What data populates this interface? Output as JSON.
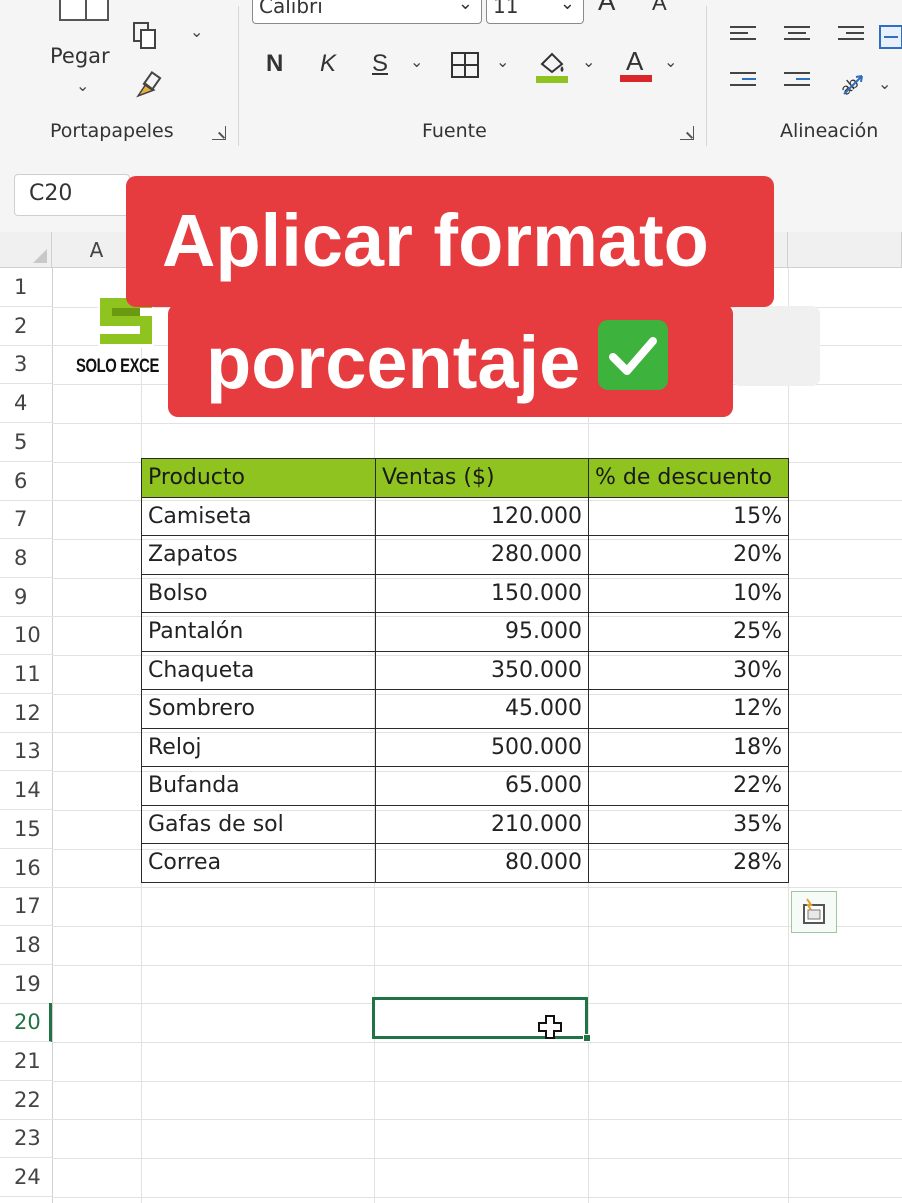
{
  "ribbon": {
    "paste_label": "Pegar",
    "clipboard_group": "Portapapeles",
    "font_group": "Fuente",
    "align_group": "Alineación",
    "font_name": "Calibri",
    "font_size": "11",
    "bold": "N",
    "italic": "K",
    "underline": "S",
    "grow_font": "A",
    "shrink_font": "A",
    "font_color_letter": "A",
    "fill_color": "#8fc31f",
    "font_color": "#d9262b"
  },
  "name_box": "C20",
  "columns": [
    "A"
  ],
  "rows": [
    "1",
    "2",
    "3",
    "4",
    "5",
    "6",
    "7",
    "8",
    "9",
    "10",
    "11",
    "12",
    "13",
    "14",
    "15",
    "16",
    "17",
    "18",
    "19",
    "20",
    "21",
    "22",
    "23",
    "24"
  ],
  "selected_row": "20",
  "logo": {
    "text": "SOLO EXCE"
  },
  "banner": {
    "line1": "Aplicar formato",
    "line2": "porcentaje"
  },
  "table": {
    "headers": [
      "Producto",
      "Ventas ($)",
      "% de descuento"
    ],
    "rows": [
      [
        "Camiseta",
        "120.000",
        "15%"
      ],
      [
        "Zapatos",
        "280.000",
        "20%"
      ],
      [
        "Bolso",
        "150.000",
        "10%"
      ],
      [
        "Pantalón",
        "95.000",
        "25%"
      ],
      [
        "Chaqueta",
        "350.000",
        "30%"
      ],
      [
        "Sombrero",
        "45.000",
        "12%"
      ],
      [
        "Reloj",
        "500.000",
        "18%"
      ],
      [
        "Bufanda",
        "65.000",
        "22%"
      ],
      [
        "Gafas de sol",
        "210.000",
        "35%"
      ],
      [
        "Correa",
        "80.000",
        "28%"
      ]
    ]
  },
  "colors": {
    "accent": "#217346",
    "header_fill": "#8fc31f",
    "banner": "#e63c3f",
    "check": "#3db23d"
  }
}
